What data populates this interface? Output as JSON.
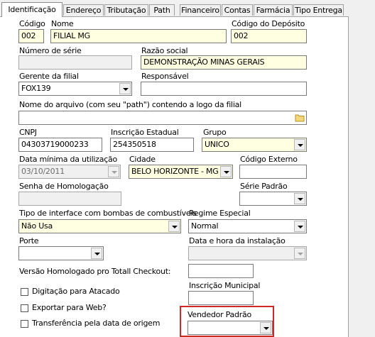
{
  "tabs": [
    "Identificação",
    "Endereço",
    "Tributação",
    "Path",
    "Financeiro",
    "Contas",
    "Farmácia",
    "Tipo Entrega"
  ],
  "labels": {
    "codigo": "Código",
    "nome": "Nome",
    "codigo_deposito": "Código do Depósito",
    "numero_serie": "Número de série",
    "razao_social": "Razão social",
    "gerente": "Gerente da filial",
    "responsavel": "Responsável",
    "logo": "Nome do arquivo (com seu \"path\") contendo a logo da filial",
    "cnpj": "CNPJ",
    "inscricao_estadual": "Inscrição Estadual",
    "grupo": "Grupo",
    "data_minima": "Data mínima da utilização",
    "cidade": "Cidade",
    "codigo_externo": "Código Externo",
    "senha_homologacao": "Senha de Homologação",
    "serie_padrao": "Série Padrão",
    "tipo_interface": "Tipo de interface com bombas de combustíveis",
    "regime_especial": "Regime Especial",
    "porte": "Porte",
    "data_hora_instalacao": "Data e hora da instalação",
    "versao_homologado": "Versão Homologado pro Totall Checkout:",
    "inscricao_municipal": "Inscrição Municipal",
    "vendedor_padrao": "Vendedor Padrão"
  },
  "values": {
    "codigo": "002",
    "nome": "FILIAL MG",
    "codigo_deposito": "002",
    "numero_serie": "",
    "razao_social": "DEMONSTRAÇÃO MINAS GERAIS",
    "gerente": "FOX139",
    "responsavel": "",
    "logo": "",
    "cnpj": "04303719000233",
    "inscricao_estadual": "254350518",
    "grupo": "UNICO",
    "data_minima": "03/10/2011",
    "cidade": "BELO HORIZONTE - MG",
    "codigo_externo": "",
    "senha_homologacao": "",
    "serie_padrao": "",
    "tipo_interface": "Não Usa",
    "regime_especial": "Normal",
    "porte": "",
    "data_hora_instalacao": "",
    "versao_homologado": "",
    "inscricao_municipal": "",
    "vendedor_padrao": ""
  },
  "checkboxes": [
    {
      "label": "Digitação para Atacado",
      "checked": false
    },
    {
      "label": "Exportar para Web?",
      "checked": false
    },
    {
      "label": "Transferência pela data de origem",
      "checked": false
    }
  ],
  "colors": {
    "required_field_bg": "#ffffe1",
    "highlight_border": "#cc2a2a"
  }
}
